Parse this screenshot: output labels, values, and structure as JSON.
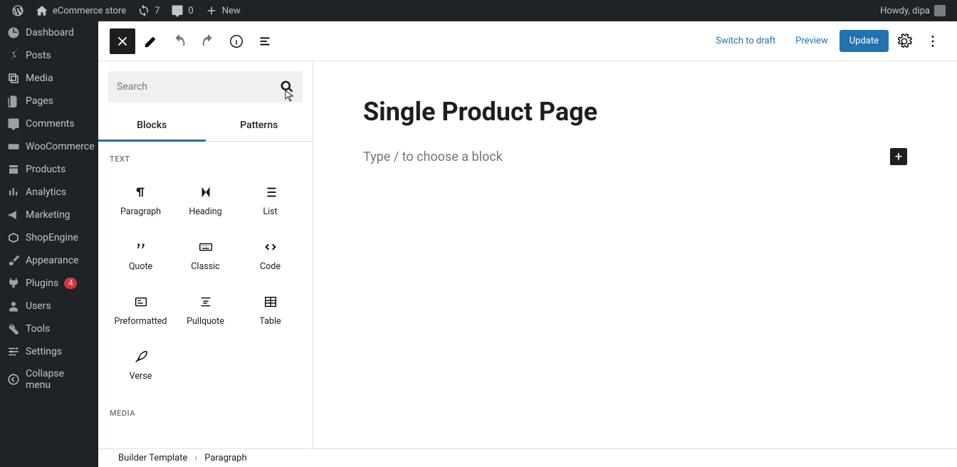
{
  "adminbar": {
    "site_name": "eCommerce store",
    "updates": "7",
    "comments": "0",
    "new_label": "New",
    "howdy": "Howdy, dipa"
  },
  "sidebar": {
    "items": [
      {
        "label": "Dashboard"
      },
      {
        "label": "Posts"
      },
      {
        "label": "Media"
      },
      {
        "label": "Pages"
      },
      {
        "label": "Comments"
      },
      {
        "label": "WooCommerce"
      },
      {
        "label": "Products"
      },
      {
        "label": "Analytics"
      },
      {
        "label": "Marketing"
      },
      {
        "label": "ShopEngine"
      },
      {
        "label": "Appearance"
      },
      {
        "label": "Plugins",
        "badge": "4"
      },
      {
        "label": "Users"
      },
      {
        "label": "Tools"
      },
      {
        "label": "Settings"
      },
      {
        "label": "Collapse menu"
      }
    ]
  },
  "toolbar": {
    "switch_draft": "Switch to draft",
    "preview": "Preview",
    "update": "Update"
  },
  "inserter": {
    "search_placeholder": "Search",
    "tabs": {
      "blocks": "Blocks",
      "patterns": "Patterns"
    },
    "groups": [
      {
        "label": "TEXT",
        "blocks": [
          {
            "label": "Paragraph"
          },
          {
            "label": "Heading"
          },
          {
            "label": "List"
          },
          {
            "label": "Quote"
          },
          {
            "label": "Classic"
          },
          {
            "label": "Code"
          },
          {
            "label": "Preformatted"
          },
          {
            "label": "Pullquote"
          },
          {
            "label": "Table"
          },
          {
            "label": "Verse"
          }
        ]
      },
      {
        "label": "MEDIA",
        "blocks": []
      }
    ]
  },
  "canvas": {
    "title": "Single Product Page",
    "placeholder": "Type / to choose a block"
  },
  "breadcrumb": {
    "root": "Builder Template",
    "current": "Paragraph"
  }
}
